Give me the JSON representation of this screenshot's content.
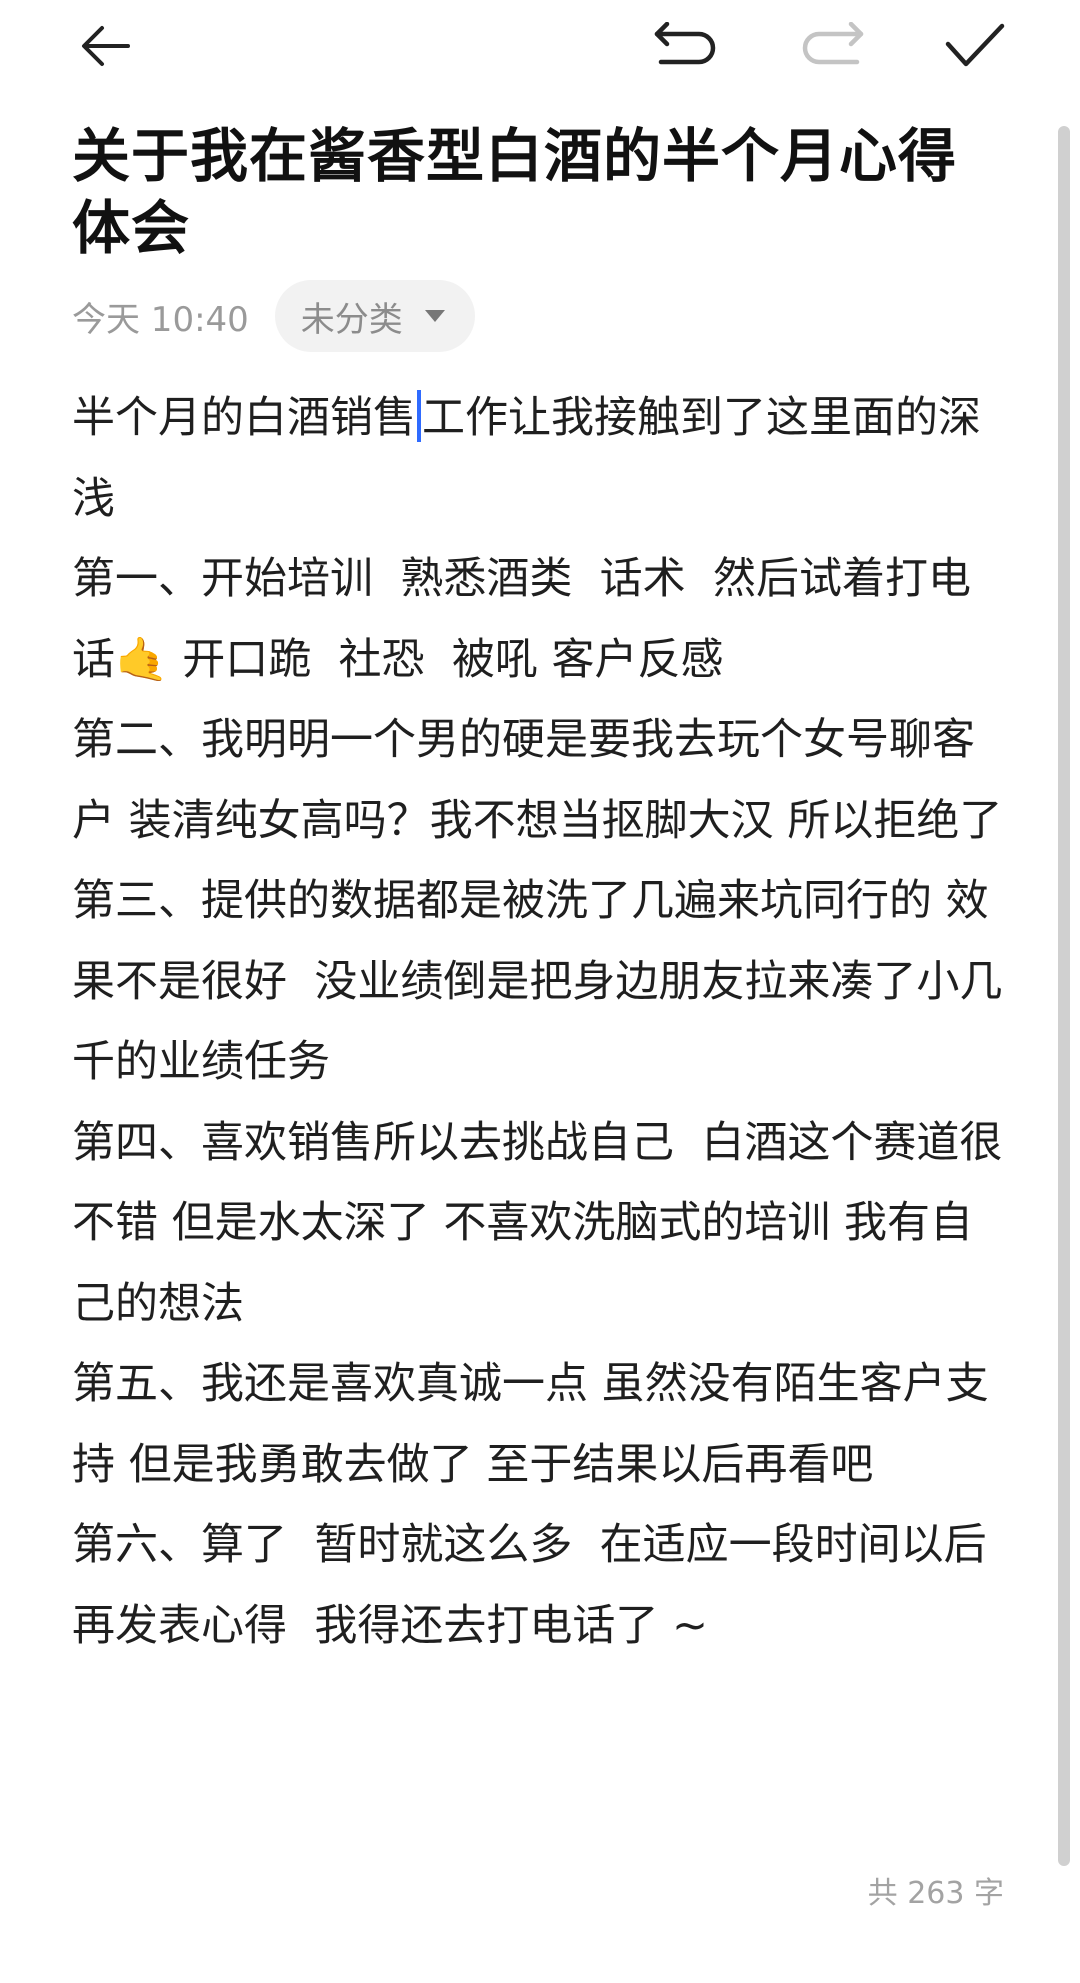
{
  "toolbar": {
    "back_icon": "arrow-left-icon",
    "undo_icon": "undo-icon",
    "redo_icon": "redo-icon",
    "done_icon": "check-icon"
  },
  "note": {
    "title": "关于我在酱香型白酒的半个月心得体会",
    "time": "今天 10:40",
    "category": "未分类",
    "paragraphs": [
      {
        "before_caret": "半个月的白酒销售",
        "after_caret": "工作让我接触到了这里面的深浅"
      },
      {
        "text": "第一、开始培训  熟悉酒类  话术  然后试着打电话🤙 开口跪  社恐  被吼 客户反感"
      },
      {
        "text": "第二、我明明一个男的硬是要我去玩个女号聊客户 装清纯女高吗？我不想当抠脚大汉 所以拒绝了"
      },
      {
        "text": "第三、提供的数据都是被洗了几遍来坑同行的 效果不是很好  没业绩倒是把身边朋友拉来凑了小几千的业绩任务"
      },
      {
        "text": "第四、喜欢销售所以去挑战自己  白酒这个赛道很不错 但是水太深了 不喜欢洗脑式的培训 我有自己的想法"
      },
      {
        "text": "第五、我还是喜欢真诚一点 虽然没有陌生客户支持 但是我勇敢去做了 至于结果以后再看吧"
      },
      {
        "text": "第六、算了  暂时就这么多  在适应一段时间以后再发表心得  我得还去打电话了 ~"
      }
    ],
    "word_count": "共 263 字"
  },
  "colors": {
    "caret": "#2f6bff",
    "muted": "#9a9a9a",
    "chip_bg": "#f2f2f2"
  }
}
